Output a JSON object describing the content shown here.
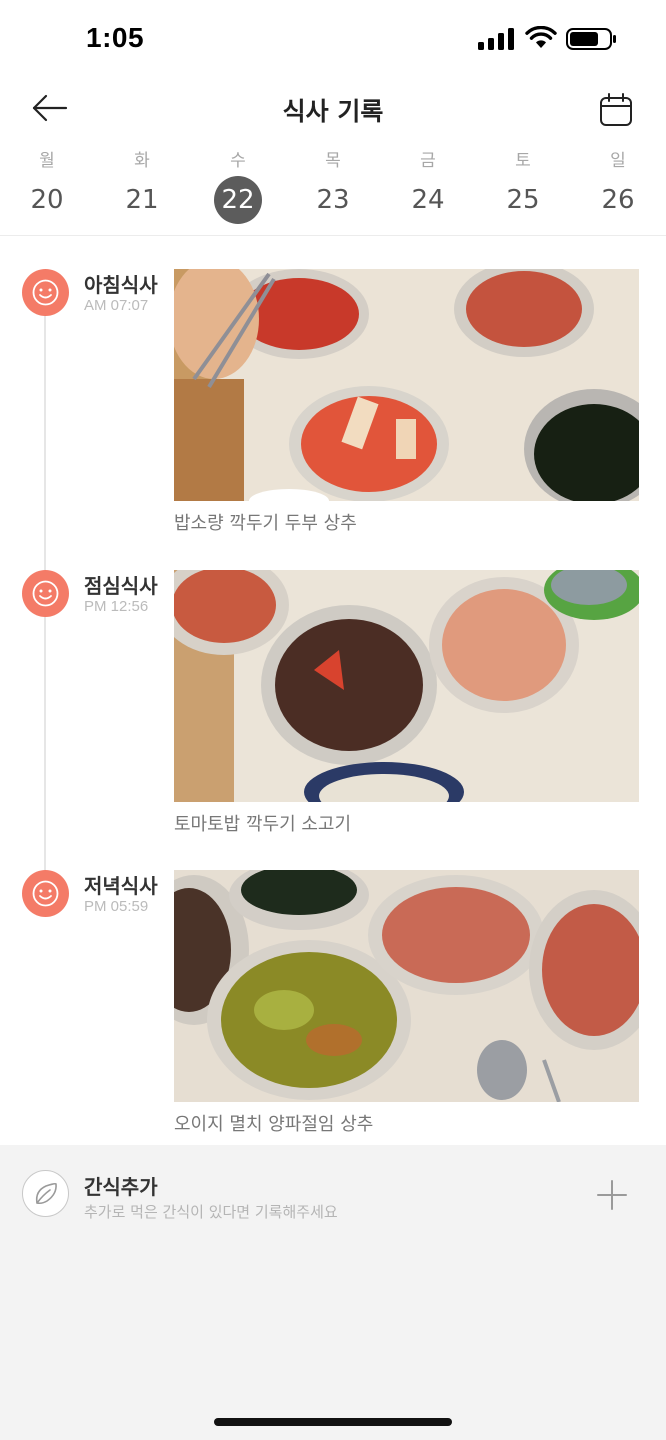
{
  "status_bar": {
    "time": "1:05"
  },
  "header": {
    "title": "식사 기록",
    "back_icon": "arrow-left-icon",
    "calendar_icon": "calendar-icon"
  },
  "week": {
    "selected_index": 2,
    "days": [
      {
        "name": "월",
        "date": "20"
      },
      {
        "name": "화",
        "date": "21"
      },
      {
        "name": "수",
        "date": "22"
      },
      {
        "name": "목",
        "date": "23"
      },
      {
        "name": "금",
        "date": "24"
      },
      {
        "name": "토",
        "date": "25"
      },
      {
        "name": "일",
        "date": "26"
      }
    ]
  },
  "meals": [
    {
      "name": "아침식사",
      "time": "AM 07:07",
      "foods": "밥소량 깍두기 두부 상추",
      "icon": "smiley-icon"
    },
    {
      "name": "점심식사",
      "time": "PM 12:56",
      "foods": "토마토밥 깍두기 소고기",
      "icon": "smiley-icon"
    },
    {
      "name": "저녁식사",
      "time": "PM 05:59",
      "foods": "오이지 멸치 양파절임 상추",
      "icon": "smiley-icon"
    }
  ],
  "snack": {
    "title": "간식추가",
    "subtitle": "추가로 먹은 간식이 있다면 기록해주세요",
    "icon": "leaf-icon",
    "add_icon": "plus-icon"
  },
  "colors": {
    "accent": "#f47b67",
    "selected_day": "#5c5c5c",
    "snack_bg": "#f3f3f3"
  }
}
